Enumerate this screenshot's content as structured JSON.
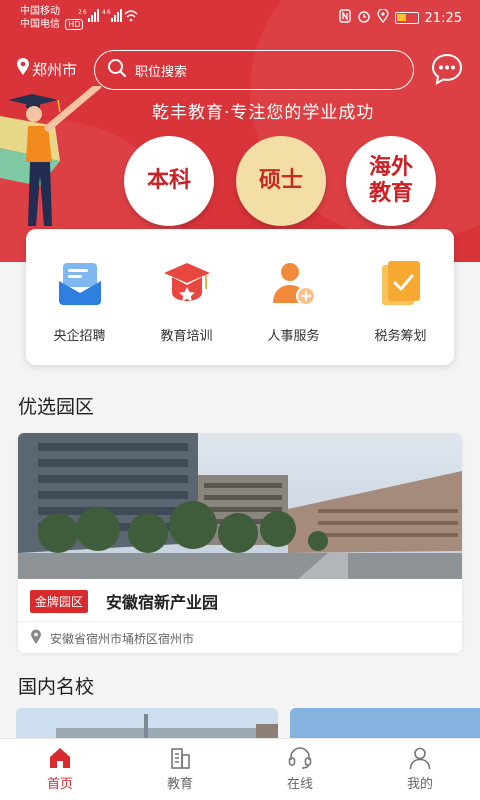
{
  "status_bar": {
    "carrier1": "中国移动",
    "carrier2": "中国电信",
    "hd_tag": "HD",
    "signal_text": "26 46",
    "time": "21:25"
  },
  "header": {
    "city": "郑州市",
    "search_placeholder": "职位搜索",
    "slogan": "乾丰教育·专注您的学业成功"
  },
  "edu_buttons": [
    {
      "label": "本科"
    },
    {
      "label": "硕士"
    },
    {
      "label": "海外\n教育"
    }
  ],
  "services": [
    {
      "label": "央企招聘",
      "icon": "envelope-icon"
    },
    {
      "label": "教育培训",
      "icon": "graduation-cap-icon"
    },
    {
      "label": "人事服务",
      "icon": "person-add-icon"
    },
    {
      "label": "税务筹划",
      "icon": "tax-document-icon"
    }
  ],
  "sections": {
    "parks_title": "优选园区",
    "schools_title": "国内名校"
  },
  "park": {
    "badge": "金牌园区",
    "name": "安徽宿新产业园",
    "address": "安徽省宿州市埇桥区宿州市"
  },
  "tabs": [
    {
      "label": "首页",
      "icon": "home-icon",
      "active": true
    },
    {
      "label": "教育",
      "icon": "building-icon",
      "active": false
    },
    {
      "label": "在线",
      "icon": "headset-icon",
      "active": false
    },
    {
      "label": "我的",
      "icon": "user-icon",
      "active": false
    }
  ],
  "colors": {
    "brand_red": "#d9343a",
    "accent_gold": "#f3dfa6",
    "active_tab": "#d92b2e"
  }
}
